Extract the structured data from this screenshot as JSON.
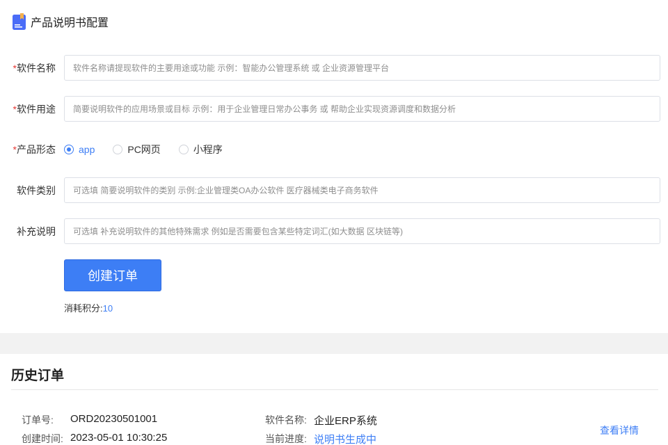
{
  "header": {
    "title": "产品说明书配置",
    "icon": "document-icon"
  },
  "form": {
    "software_name": {
      "required_mark": "*",
      "label": "软件名称",
      "placeholder": "软件名称请提现软件的主要用途或功能 示例：智能办公管理系统 或 企业资源管理平台",
      "value": ""
    },
    "software_purpose": {
      "required_mark": "*",
      "label": "软件用途",
      "placeholder": "简要说明软件的应用场景或目标 示例：用于企业管理日常办公事务 或 帮助企业实现资源调度和数据分析",
      "value": ""
    },
    "product_form": {
      "required_mark": "*",
      "label": "产品形态",
      "options": [
        "app",
        "PC网页",
        "小程序"
      ],
      "selected": "app"
    },
    "software_category": {
      "label": "软件类别",
      "placeholder": "可选填 简要说明软件的类别 示例:企业管理类OA办公软件 医疗器械类电子商务软件",
      "value": ""
    },
    "extra_notes": {
      "label": "补充说明",
      "placeholder": "可选填 补充说明软件的其他特殊需求 例如是否需要包含某些特定词汇(如大数据 区块链等)",
      "value": ""
    },
    "create_button": "创建订单",
    "cost_label": "消耗积分:",
    "cost_value": "10"
  },
  "history": {
    "title": "历史订单",
    "orders": [
      {
        "order_no_label": "订单号:",
        "order_no": "ORD20230501001",
        "created_label": "创建时间:",
        "created": "2023-05-01 10:30:25",
        "name_label": "软件名称:",
        "name": "企业ERP系统",
        "progress_label": "当前进度:",
        "progress": "说明书生成中",
        "detail_link": "查看详情"
      }
    ]
  },
  "colors": {
    "accent": "#3d7ef5",
    "required": "#e53935",
    "band": "#f2f2f2"
  }
}
